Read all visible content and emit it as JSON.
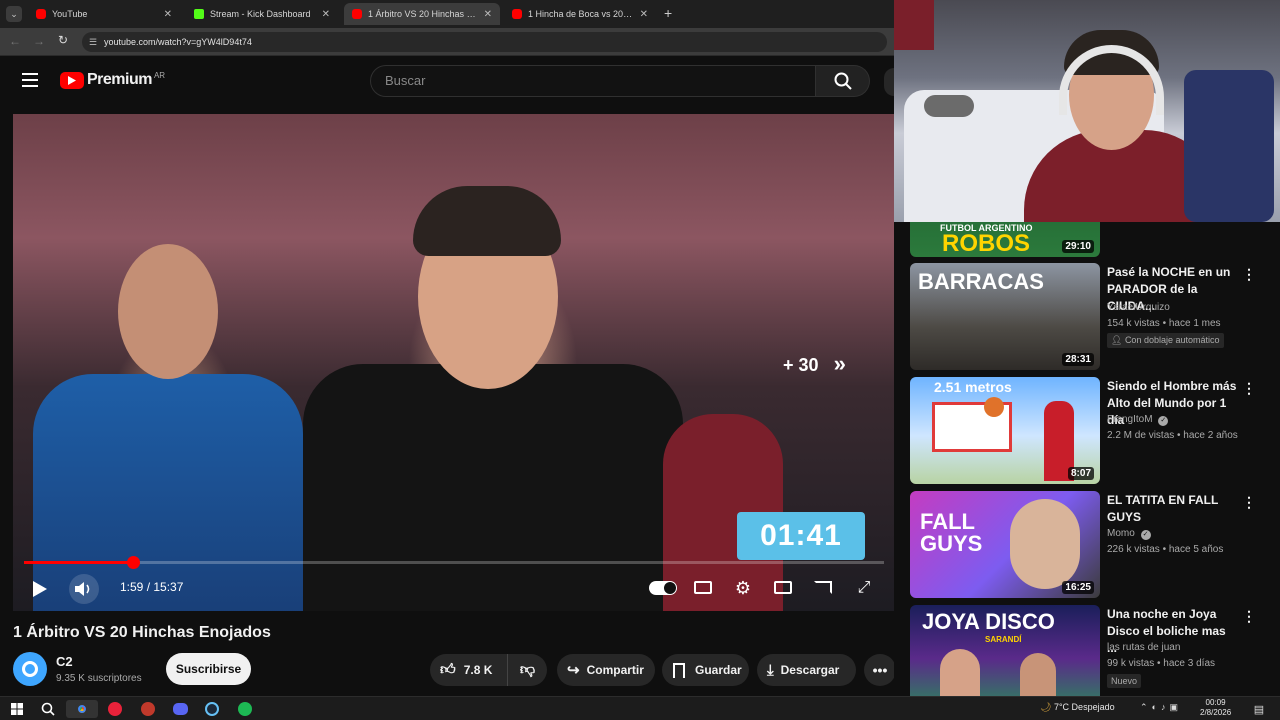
{
  "browser": {
    "tabs": [
      {
        "title": "YouTube"
      },
      {
        "title": "Stream - Kick Dashboard"
      },
      {
        "title": "1 Árbitro VS 20 Hinchas Enojad"
      },
      {
        "title": "1 Hincha de Boca vs 20 Hinchas"
      }
    ],
    "url": "youtube.com/watch?v=gYW4lD94t74"
  },
  "yt_header": {
    "logo_text": "Premium",
    "region": "AR",
    "search_placeholder": "Buscar"
  },
  "player": {
    "time_display": "1:59 / 15:37",
    "progress": 0.127,
    "skip_label": "+ 30",
    "overlay_timer": "01:41"
  },
  "video": {
    "title": "1 Árbitro VS 20 Hinchas Enojados",
    "channel_name": "C2",
    "channel_subs": "9.35 K suscriptores",
    "subscribe_label": "Suscribirse",
    "likes": "7.8 K",
    "share_label": "Compartir",
    "save_label": "Guardar",
    "download_label": "Descargar"
  },
  "sidebar": {
    "items": [
      {
        "thumb_text": "ROBOS",
        "thumb_top": "FUTBOL ARGENTINO",
        "duration": "29:10"
      },
      {
        "thumb_text": "BARRACAS",
        "duration": "28:31",
        "title": "Pasé la NOCHE en un PARADOR de la CIUDA...",
        "channel": "YsraelUrquizo",
        "meta": "154 k vistas • hace 1 mes",
        "badge": "Con doblaje automático"
      },
      {
        "thumb_text": "2.51 metros",
        "duration": "8:07",
        "title": "Siendo el Hombre más Alto del Mundo por 1 día",
        "channel": "FrangItoM",
        "meta": "2.2 M de vistas • hace 2 años"
      },
      {
        "thumb_text": "FALL GUYS",
        "duration": "16:25",
        "title": "EL TATITA EN FALL GUYS",
        "channel": "Momo",
        "meta": "226 k vistas • hace 5 años"
      },
      {
        "thumb_text": "JOYA DISCO",
        "thumb_sub": "SARANDÍ",
        "title": "Una noche en Joya Disco el boliche mas ...",
        "channel": "las rutas de juan",
        "meta": "99 k vistas • hace 3 días",
        "badge": "Nuevo"
      }
    ]
  },
  "taskbar": {
    "weather": "7°C  Despejado",
    "time": "00:09",
    "date": "2/8/2026"
  },
  "colors": {
    "accent_red": "#ff0000",
    "bg": "#0f0f0f",
    "timer_blue": "#5bc0e8"
  }
}
